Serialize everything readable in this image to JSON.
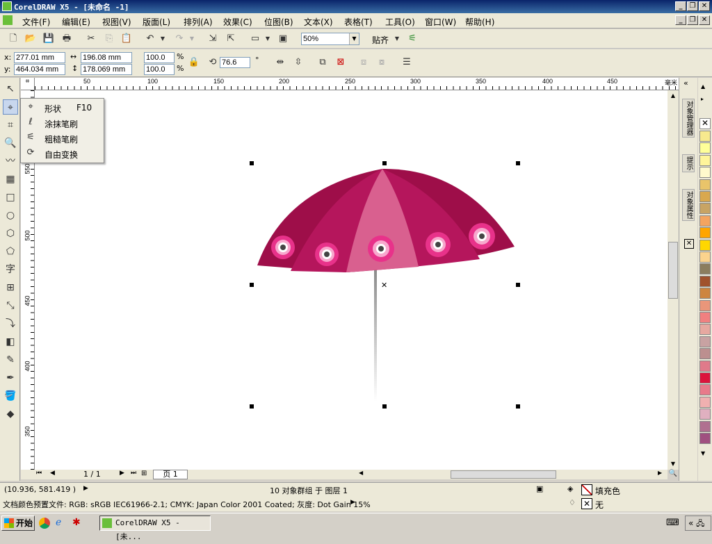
{
  "window": {
    "title": "CorelDRAW X5 - [未命名 -1]"
  },
  "menu": [
    "文件(F)",
    "编辑(E)",
    "视图(V)",
    "版面(L)",
    "排列(A)",
    "效果(C)",
    "位图(B)",
    "文本(X)",
    "表格(T)",
    "工具(O)",
    "窗口(W)",
    "帮助(H)"
  ],
  "toolbar": {
    "zoom_value": "50%",
    "snap_label": "贴齐"
  },
  "propbar": {
    "x_label": "x:",
    "x_value": "277.01 mm",
    "y_label": "y:",
    "y_value": "464.034 mm",
    "width_value": "196.08 mm",
    "height_value": "178.069 mm",
    "scale_x": "100.0",
    "scale_y": "100.0",
    "pct": "%",
    "rotation": "76.6",
    "deg": "°"
  },
  "ruler": {
    "h_ticks": [
      "50",
      "100",
      "150",
      "200",
      "250",
      "300",
      "350",
      "400",
      "450"
    ],
    "h_unit": "毫米",
    "v_ticks": [
      "550",
      "500",
      "450",
      "400",
      "350"
    ]
  },
  "popup": {
    "items": [
      {
        "label": "形状",
        "shortcut": "F10",
        "icon": "shape-tool-icon"
      },
      {
        "label": "涂抹笔刷",
        "icon": "smudge-brush-icon"
      },
      {
        "label": "粗糙笔刷",
        "icon": "roughen-brush-icon"
      },
      {
        "label": "自由变换",
        "icon": "free-transform-icon"
      }
    ]
  },
  "pagenav": {
    "page_count": "1 / 1",
    "page_tab": "页 1"
  },
  "dock": {
    "tabs": [
      "对象管理器",
      "提示",
      "对象属性"
    ]
  },
  "palette": [
    "#f7e98e",
    "#ffff99",
    "#fff59a",
    "#fffacd",
    "#e9c46a",
    "#d9a84e",
    "#c8a464",
    "#f4a460",
    "#ffa500",
    "#ffd700",
    "#fbd38d",
    "#8b7d5e",
    "#a0522d",
    "#cd853f",
    "#e9967a",
    "#f08080",
    "#e6a8a0",
    "#c8a2a2",
    "#bc8f8f",
    "#e07a8a",
    "#dc143c",
    "#e87a8a",
    "#f0b0b0",
    "#e0b0c0",
    "#b07090",
    "#a05080"
  ],
  "status": {
    "coords": "(10.936, 581.419 )",
    "selection": "10 对象群组 于 图层 1",
    "profile": "文档颜色预置文件: RGB: sRGB IEC61966-2.1; CMYK: Japan Color 2001 Coated; 灰度: Dot Gain 15%",
    "fill_label": "填充色",
    "outline_label": "无"
  },
  "taskbar": {
    "start": "开始",
    "task": "CorelDRAW X5 - [未..."
  },
  "colors": {
    "umbrella_dark": "#9e0e49",
    "umbrella_mid": "#b5165c",
    "umbrella_light": "#d9608f",
    "flower": "#e8328a"
  }
}
